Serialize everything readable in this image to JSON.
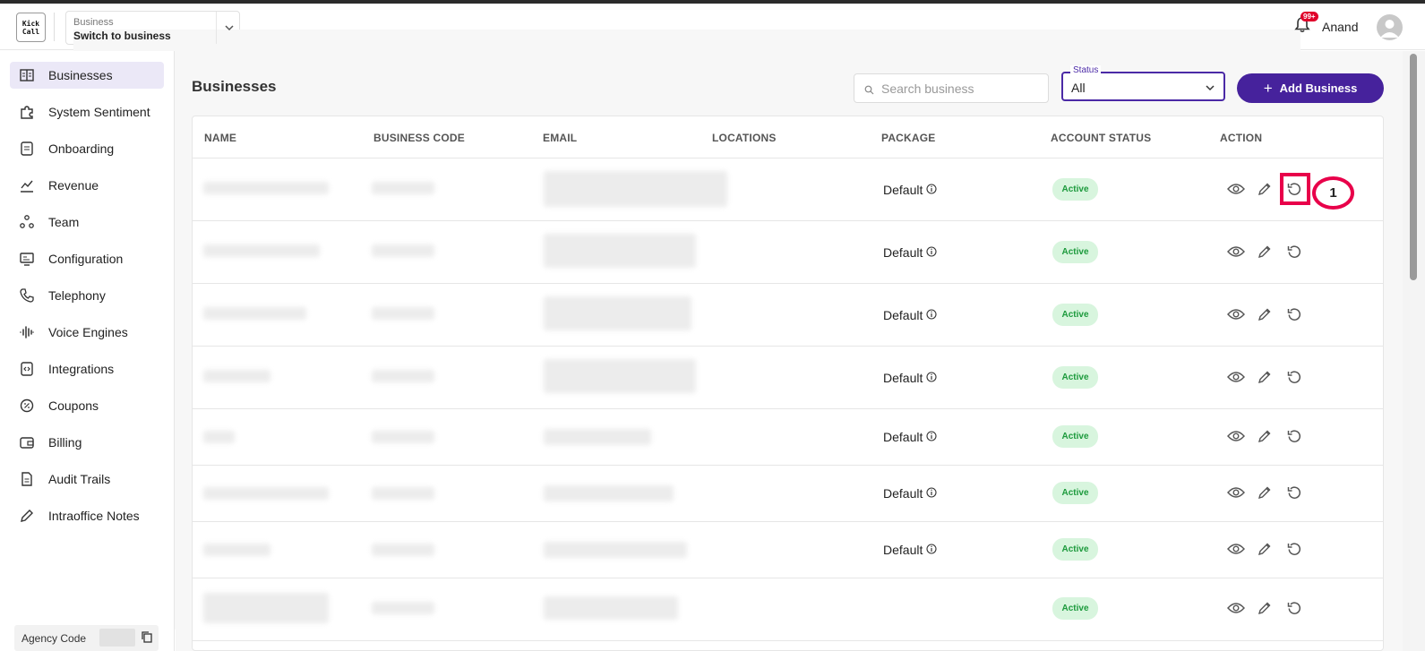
{
  "header": {
    "logo_text": "Kick Call",
    "switcher": {
      "sub_label": "Business",
      "main_label": "Switch to business"
    },
    "notifications": {
      "badge": "99+"
    },
    "user": {
      "name": "Anand"
    }
  },
  "sidebar": {
    "items": [
      {
        "label": "Businesses",
        "icon": "building-icon",
        "active": true
      },
      {
        "label": "System Sentiment",
        "icon": "puzzle-icon"
      },
      {
        "label": "Onboarding",
        "icon": "document-icon"
      },
      {
        "label": "Revenue",
        "icon": "chart-icon"
      },
      {
        "label": "Team",
        "icon": "team-icon"
      },
      {
        "label": "Configuration",
        "icon": "monitor-icon"
      },
      {
        "label": "Telephony",
        "icon": "phone-icon"
      },
      {
        "label": "Voice Engines",
        "icon": "waveform-icon"
      },
      {
        "label": "Integrations",
        "icon": "code-icon"
      },
      {
        "label": "Coupons",
        "icon": "coupon-icon"
      },
      {
        "label": "Billing",
        "icon": "wallet-icon"
      },
      {
        "label": "Audit Trails",
        "icon": "file-icon"
      },
      {
        "label": "Intraoffice Notes",
        "icon": "pencil-icon"
      }
    ],
    "agency_code_label": "Agency Code"
  },
  "page": {
    "title": "Businesses",
    "search_placeholder": "Search business",
    "status_filter": {
      "label": "Status",
      "value": "All"
    },
    "add_button_label": "Add Business"
  },
  "table": {
    "columns": [
      "NAME",
      "BUSINESS CODE",
      "EMAIL",
      "LOCATIONS",
      "PACKAGE",
      "ACCOUNT STATUS",
      "ACTION"
    ],
    "rows": [
      {
        "package": "Default",
        "status": "Active"
      },
      {
        "package": "Default",
        "status": "Active"
      },
      {
        "package": "Default",
        "status": "Active"
      },
      {
        "package": "Default",
        "status": "Active"
      },
      {
        "package": "Default",
        "status": "Active"
      },
      {
        "package": "Default",
        "status": "Active"
      },
      {
        "package": "Default",
        "status": "Active"
      },
      {
        "package": "",
        "status": "Active"
      }
    ]
  },
  "annotation": {
    "label": "1"
  },
  "colors": {
    "accent": "#46229c",
    "active_badge_bg": "#d8f5de",
    "active_badge_text": "#1c9a3c",
    "highlight": "#e8004a"
  }
}
